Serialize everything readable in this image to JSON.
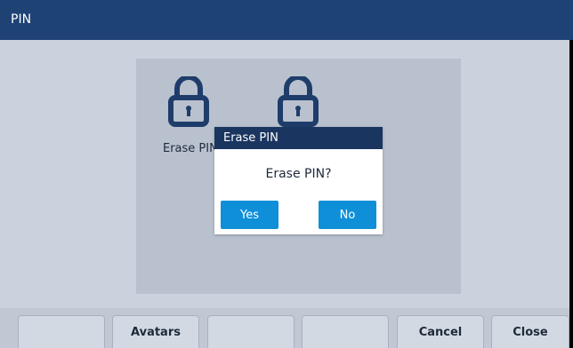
{
  "window": {
    "title": "PIN"
  },
  "pins": [
    {
      "label": "Erase PIN",
      "icon": "lock-icon"
    },
    {
      "label": "",
      "icon": "lock-icon"
    }
  ],
  "dialog": {
    "title": "Erase PIN",
    "message": "Erase PIN?",
    "yes_label": "Yes",
    "no_label": "No"
  },
  "softkeys": [
    "",
    "Avatars",
    "",
    "",
    "Cancel",
    "Close"
  ],
  "colors": {
    "titlebar": "#1f4275",
    "dialog_title": "#1a3560",
    "button_accent": "#0e8fd8",
    "lock_icon": "#1f3d6b"
  }
}
